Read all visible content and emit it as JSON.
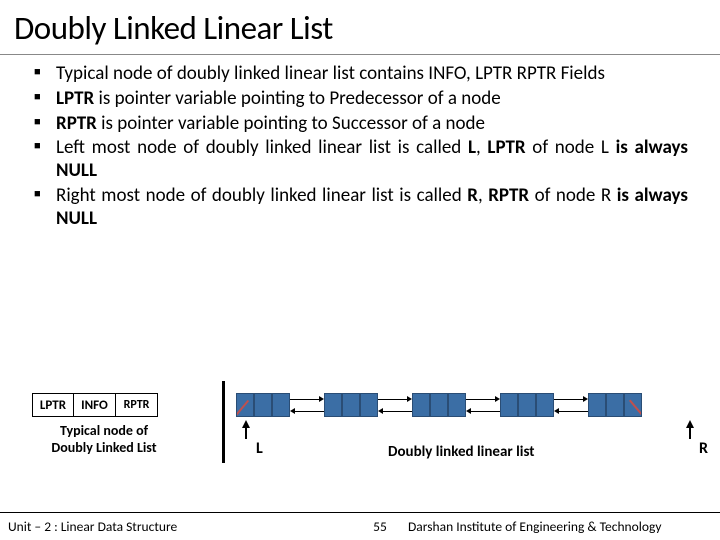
{
  "title": "Doubly Linked Linear List",
  "bullets": [
    {
      "pre": "Typical node of doubly linked linear list contains INFO, LPTR  RPTR Fields"
    },
    {
      "pre": "",
      "b1": "LPTR",
      "mid": " is pointer variable pointing to Predecessor of a node"
    },
    {
      "pre": "",
      "b1": "RPTR",
      "mid": " is pointer variable pointing to Successor of a node"
    },
    {
      "pre": "Left most node of doubly linked linear list is called ",
      "b1": "L",
      "mid": ", ",
      "b2": "LPTR",
      "post": " of node L ",
      "b3": "is always NULL"
    },
    {
      "pre": "Right most node of doubly linked linear list is called ",
      "b1": "R",
      "mid": ", ",
      "b2": "RPTR",
      "post": " of node R ",
      "b3": "is always NULL"
    }
  ],
  "sample": {
    "c1": "LPTR",
    "c2": "INFO",
    "c3": "RPTR",
    "caption": "Typical node of Doubly Linked List"
  },
  "pointers": {
    "left": "L",
    "right": "R",
    "caption": "Doubly linked linear list"
  },
  "footer": {
    "unit": "Unit – 2 : Linear Data Structure",
    "page": "55",
    "inst": "Darshan Institute of Engineering & Technology"
  }
}
